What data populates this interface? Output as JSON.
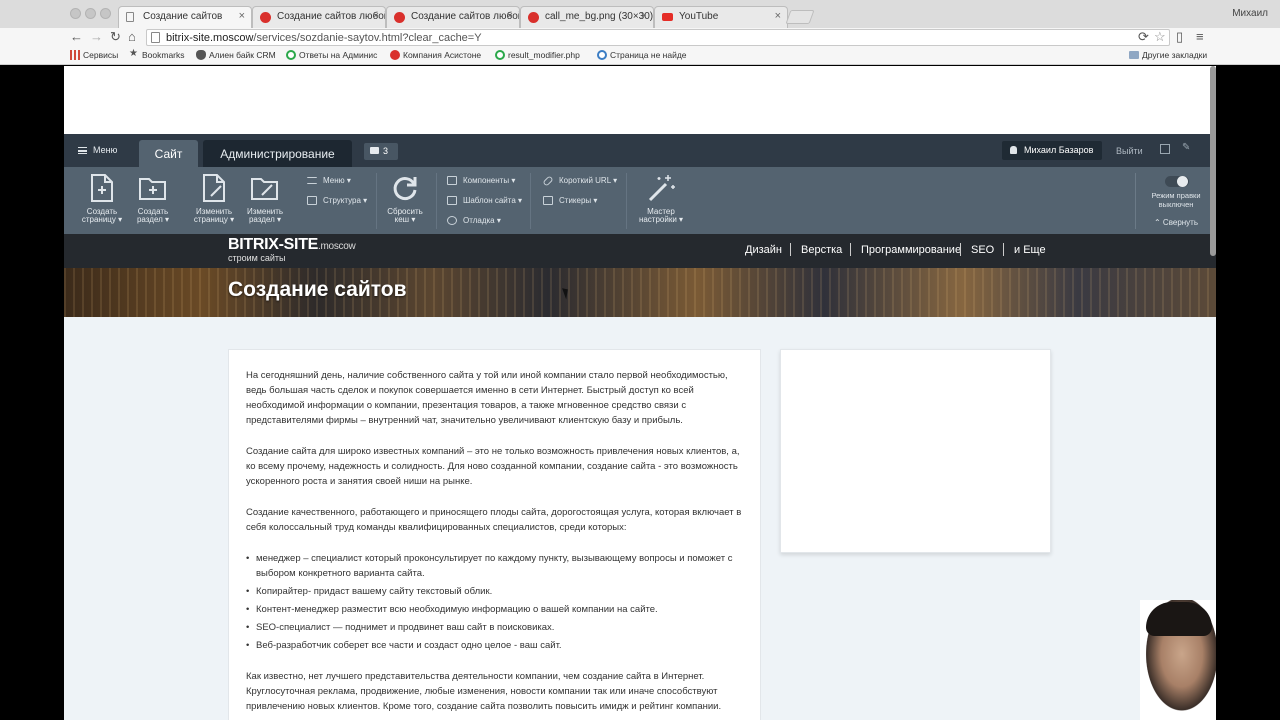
{
  "browser": {
    "tabs": [
      {
        "title": "Создание сайтов",
        "favicon_color": "#ffffff"
      },
      {
        "title": "Создание сайтов любой с",
        "favicon_color": "#d9302c"
      },
      {
        "title": "Создание сайтов любой с",
        "favicon_color": "#d9302c"
      },
      {
        "title": "call_me_bg.png (30×30)",
        "favicon_color": "#d9302c"
      },
      {
        "title": "YouTube",
        "favicon_color": "#e52d27"
      }
    ],
    "profile_name": "Михаил",
    "url_host": "bitrix-site.moscow",
    "url_path": "/services/sozdanie-saytov.html?clear_cache=Y",
    "bookmarks": [
      {
        "label": "Сервисы",
        "icon_color": "#d04a3a"
      },
      {
        "label": "Bookmarks",
        "icon_color": "#555555"
      },
      {
        "label": "Алиен байк CRM",
        "icon_color": "#555555"
      },
      {
        "label": "Ответы на Админис",
        "icon_color": "#2aa84a"
      },
      {
        "label": "Компания Асистоне",
        "icon_color": "#d9302c"
      },
      {
        "label": "result_modifier.php",
        "icon_color": "#2aa84a"
      },
      {
        "label": "Страница не найде",
        "icon_color": "#3b7dc4"
      }
    ],
    "other_bookmarks": "Другие закладки"
  },
  "admin_panel": {
    "menu_label": "Меню",
    "tab_site": "Сайт",
    "tab_admin": "Администрирование",
    "notifications_count": "3",
    "user_name": "Михаил Базаров",
    "logout_label": "Выйти",
    "tools": [
      {
        "line1": "Создать",
        "line2": "страницу ▾"
      },
      {
        "line1": "Создать",
        "line2": "раздел ▾"
      },
      {
        "line1": "Изменить",
        "line2": "страницу ▾"
      },
      {
        "line1": "Изменить",
        "line2": "раздел ▾"
      }
    ],
    "small_tools": {
      "menu": "Меню ▾",
      "structure": "Структура ▾",
      "components": "Компоненты ▾",
      "template": "Шаблон сайта ▾",
      "debug": "Отладка ▾",
      "short_url": "Короткий URL ▾",
      "stickers": "Стикеры ▾"
    },
    "reset_cache": {
      "line1": "Сбросить",
      "line2": "кеш ▾"
    },
    "wizard": {
      "line1": "Мастер",
      "line2": "настройки ▾"
    },
    "edit_mode": {
      "line1": "Режим правки",
      "line2": "выключен"
    },
    "collapse_label": "⌃ Свернуть"
  },
  "site": {
    "logo_main": "BITRIX-SITE",
    "logo_suffix": ".moscow",
    "logo_tagline": "строим сайты",
    "nav": [
      "Дизайн",
      "Верстка",
      "Программирование",
      "SEO",
      "и Еще"
    ],
    "page_title": "Создание сайтов"
  },
  "content": {
    "p1": "На сегодняшний день, наличие собственного сайта у той или иной компании стало первой необходимостью, ведь большая часть сделок и покупок совершается именно в сети Интернет. Быстрый доступ ко всей необходимой информации о компании, презентация товаров, а также мгновенное средство связи с представителями фирмы – внутренний чат, значительно увеличивают клиентскую базу и прибыль.",
    "p2": "Создание сайта для широко известных компаний – это не только возможность привлечения новых клиентов, а, ко всему прочему, надежность и солидность. Для ново созданной компании, создание сайта - это возможность ускоренного роста и занятия своей ниши на рынке.",
    "p3": "Создание качественного, работающего и приносящего плоды сайта, дорогостоящая услуга, которая включает в себя колоссальный труд команды квалифицированных специалистов, среди которых:",
    "list": [
      "менеджер – специалист который проконсультирует по каждому пункту, вызывающему вопросы и поможет с выбором конкретного варианта сайта.",
      "Копирайтер- придаст вашему сайту текстовый облик.",
      "Контент-менеджер разместит всю необходимую информацию о вашей компании на сайте.",
      "SEO-специалист — поднимет и продвинет ваш сайт в поисковиках.",
      "Веб-разработчик соберет все части и создаст одно целое - ваш сайт."
    ],
    "p4": "Как известно, нет лучшего представительства деятельности компании, чем создание сайта в Интернет. Круглосуточная реклама, продвижение, любые изменения, новости компании так или иначе способствуют привлечению новых клиентов. Кроме того, создание сайта позволить повысить имидж и рейтинг компании."
  }
}
